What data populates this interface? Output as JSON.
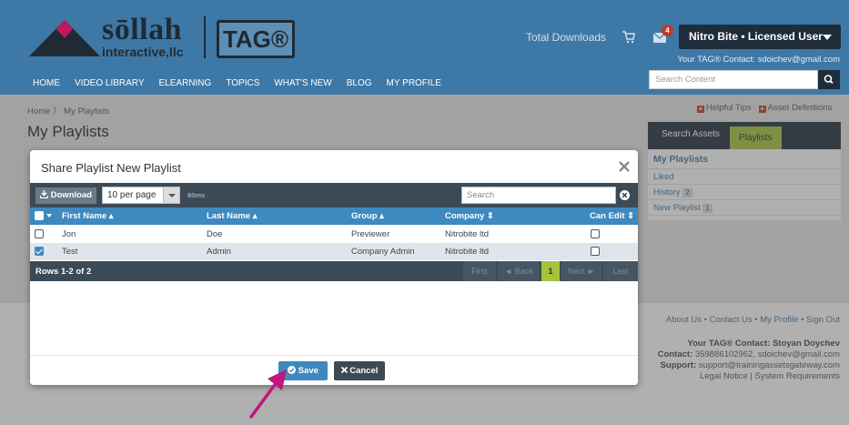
{
  "header": {
    "logo_word": "sōllah",
    "logo_sub": "interactive,llc",
    "logo_tag": "TAG®",
    "nav": [
      "HOME",
      "VIDEO LIBRARY",
      "ELEARNING",
      "TOPICS",
      "WHAT'S NEW",
      "BLOG",
      "MY PROFILE"
    ],
    "total_downloads": "Total Downloads",
    "mail_badge": "4",
    "user_menu": "Nitro Bite • Licensed User",
    "tag_contact": "Your TAG® Contact: sdoichev@gmail.com",
    "search_placeholder": "Search Content"
  },
  "breadcrumb": {
    "home": "Home",
    "current": "My Playlists"
  },
  "page_title": "My Playlists",
  "help_links": {
    "tips": "Helpful Tips",
    "definitions": "Asset Definitions"
  },
  "side_panel": {
    "tabs": [
      "Search Assets",
      "Playlists"
    ],
    "heading": "My Playlists",
    "items": [
      {
        "label": "Liked",
        "count": ""
      },
      {
        "label": "History",
        "count": "2"
      },
      {
        "label": "New Playlist",
        "count": "1"
      }
    ]
  },
  "footer": {
    "links": "About Us • Contact Us • My Profile • Sign Out",
    "contact_title": "Your TAG® Contact: Stoyan Doychev",
    "contact_label": "Contact:",
    "contact_value": "359886102962, sdoichev@gmail.com",
    "support_label": "Support:",
    "support_value": "support@trainingassetsgateway.com",
    "legal": "Legal Notice | System Requirements"
  },
  "modal": {
    "title": "Share Playlist New Playlist",
    "download_label": "Download",
    "per_page": "10 per page",
    "timing": "60ms",
    "search_placeholder": "Search",
    "columns": [
      "First Name",
      "Last Name",
      "Group",
      "Company",
      "Can Edit"
    ],
    "rows": [
      {
        "first": "Jon",
        "last": "Doe",
        "group": "Previewer",
        "company": "Nitrobite ltd",
        "selected": false,
        "can_edit": false
      },
      {
        "first": "Test",
        "last": "Admin",
        "group": "Company Admin",
        "company": "Nitrobite ltd",
        "selected": true,
        "can_edit": false
      }
    ],
    "rows_info": "Rows 1-2 of 2",
    "pager": {
      "first": "First",
      "back": "◄ Back",
      "page": "1",
      "next": "Next ►",
      "last": "Last"
    },
    "save_label": "Save",
    "cancel_label": "Cancel"
  },
  "colors": {
    "header_blue": "#3e78a6",
    "table_header": "#3e89bf",
    "dark": "#3b4a57",
    "accent_green": "#a6c33b",
    "arrow_magenta": "#c0177c"
  }
}
